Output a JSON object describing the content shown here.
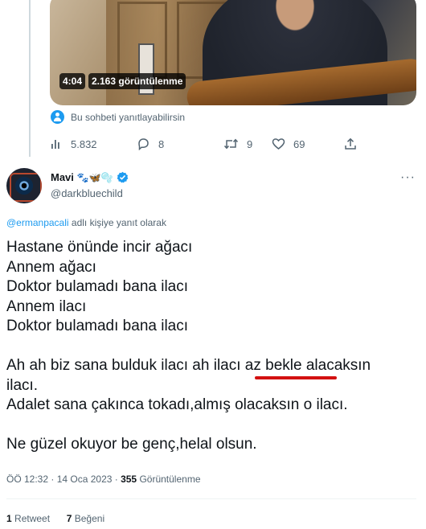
{
  "video": {
    "duration": "4:04",
    "views": "2.163 görüntülenme"
  },
  "reply_permission": "Bu sohbeti yanıtlayabilirsin",
  "prev_tweet_actions": {
    "views": "5.832",
    "replies": "8",
    "retweets": "9",
    "likes": "69"
  },
  "author": {
    "display_name": "Mavi",
    "emojis": "🐾🦋🫧",
    "handle": "@darkbluechild",
    "verified_color": "#1d9bf0"
  },
  "reply_to": {
    "mention": "@ermanpacali",
    "suffix": " adlı kişiye yanıt olarak"
  },
  "tweet_text": "Hastane önünde incir ağacı\nAnnem ağacı\nDoktor bulamadı bana ilacı\nAnnem ilacı\nDoktor bulamadı bana ilacı\n\nAh ah biz sana bulduk ilacı ah ilacı az bekle alacaksın\nilacı.\nAdalet sana çakınca tokadı,almış olacaksın o ilacı.\n\nNe güzel okuyor be genç,helal olsun.",
  "meta": {
    "time_date": "ÖÖ 12:32 · 14 Oca 2023 · ",
    "view_count": "355",
    "view_label": " Görüntülenme"
  },
  "stats": {
    "retweet_count": "1",
    "retweet_label": " Retweet",
    "like_count": "7",
    "like_label": " Beğeni"
  },
  "colors": {
    "accent": "#1d9bf0",
    "annotation_underline": "#d31111",
    "secondary_text": "#536471"
  }
}
